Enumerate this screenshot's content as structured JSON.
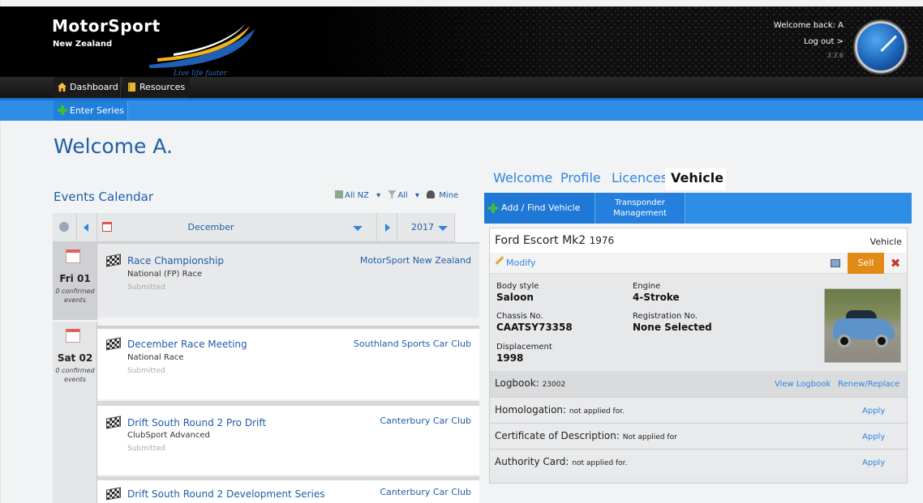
{
  "header": {
    "logo_title": "MotorSport",
    "logo_subtitle": "New Zealand",
    "logo_tagline": "Live life faster",
    "welcome_back": "Welcome back: A",
    "logout": "Log out >",
    "version": "3.3.6"
  },
  "nav": {
    "dashboard": "Dashboard",
    "resources": "Resources",
    "enter_series": "Enter Series"
  },
  "page_title": "Welcome A.",
  "calendar": {
    "title": "Events Calendar",
    "filter_region": "All NZ",
    "filter_type": "All",
    "filter_mine": "Mine",
    "month": "December",
    "year": "2017",
    "days": [
      {
        "label": "Fri 01",
        "note": "0 confirmed events"
      },
      {
        "label": "Sat 02",
        "note": "0 confirmed events"
      }
    ],
    "events": [
      {
        "title": "Race Championship",
        "type": "National (FP) Race",
        "status": "Submitted",
        "club": "MotorSport New Zealand"
      },
      {
        "title": "December Race Meeting",
        "type": "National Race",
        "status": "Submitted",
        "club": "Southland Sports Car Club"
      },
      {
        "title": "Drift South Round 2 Pro Drift",
        "type": "ClubSport Advanced",
        "status": "Submitted",
        "club": "Canterbury Car Club"
      },
      {
        "title": "Drift South Round 2 Development Series",
        "type": "",
        "status": "",
        "club": "Canterbury Car Club"
      }
    ]
  },
  "tabs": {
    "welcome": "Welcome",
    "profile": "Profile",
    "licences": "Licences",
    "vehicle": "Vehicle"
  },
  "vehicle_bar": {
    "add_find": "Add / Find Vehicle",
    "transponder": "Transponder Management"
  },
  "vehicle": {
    "name": "Ford Escort Mk2",
    "year": "1976",
    "type_label": "Vehicle",
    "modify": "Modify",
    "sell": "Sell",
    "close": "✖",
    "body_style_label": "Body style",
    "body_style": "Saloon",
    "engine_label": "Engine",
    "engine": "4-Stroke",
    "chassis_label": "Chassis No.",
    "chassis": "CAATSY73358",
    "registration_label": "Registration No.",
    "registration": "None Selected",
    "displacement_label": "Displacement",
    "displacement": "1998",
    "logbook_label": "Logbook:",
    "logbook_number": "23002",
    "view_logbook": "View Logbook",
    "renew_replace": "Renew/Replace",
    "homologation_label": "Homologation:",
    "homologation_status": "not applied for.",
    "cod_label": "Certificate of Description:",
    "cod_status": "Not applied for",
    "authority_label": "Authority Card:",
    "authority_status": "not applied for.",
    "apply": "Apply"
  },
  "colors": {
    "brand_blue": "#1f5da8",
    "link_blue": "#2e86de",
    "nav_blue": "#2e8ee6",
    "sell_orange": "#e38a16"
  }
}
